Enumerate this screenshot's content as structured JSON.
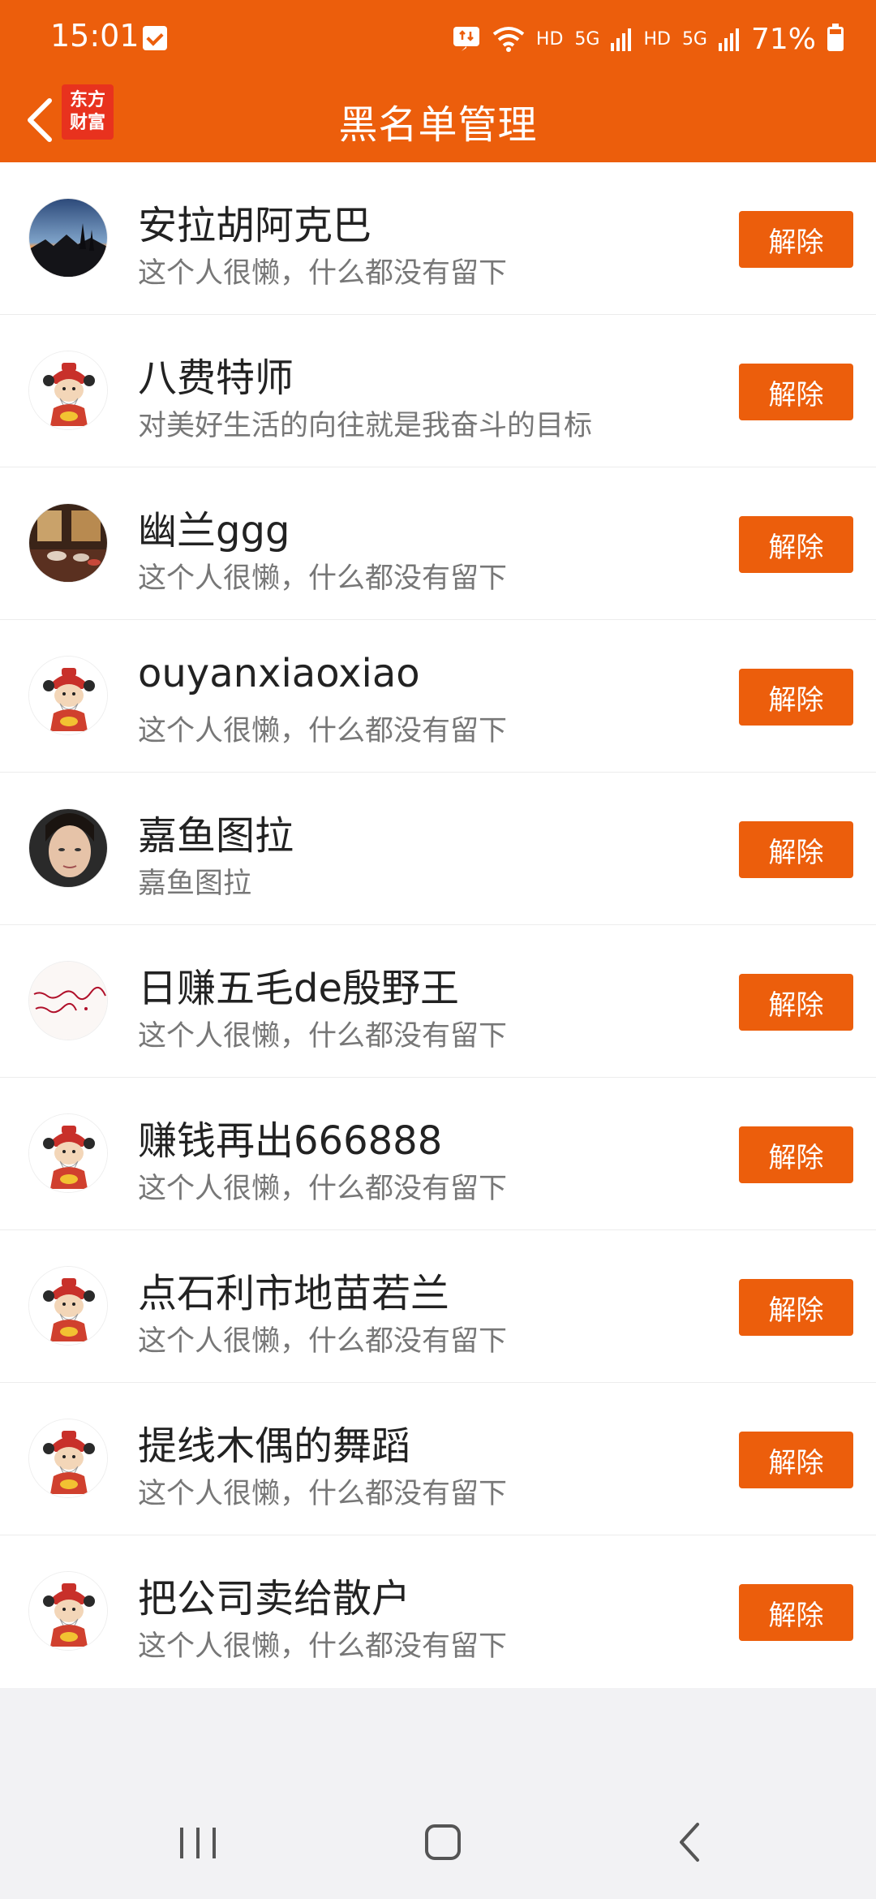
{
  "status_bar": {
    "time": "15:01",
    "hd1": "HD",
    "net1": "5G",
    "hd2": "HD",
    "net2": "5G",
    "battery": "71%"
  },
  "header": {
    "logo_line1": "东方",
    "logo_line2": "财富",
    "title": "黑名单管理"
  },
  "blocked_users": [
    {
      "name": "安拉胡阿克巴",
      "bio": "这个人很懒，什么都没有留下",
      "action": "解除",
      "avatar": "landscape-photo"
    },
    {
      "name": "八费特师",
      "bio": "对美好生活的向往就是我奋斗的目标",
      "action": "解除",
      "avatar": "god-of-wealth"
    },
    {
      "name": "幽兰ggg",
      "bio": "这个人很懒，什么都没有留下",
      "action": "解除",
      "avatar": "tea-room-photo"
    },
    {
      "name": "ouyanxiaoxiao",
      "bio": "这个人很懒，什么都没有留下",
      "action": "解除",
      "avatar": "god-of-wealth"
    },
    {
      "name": "嘉鱼图拉",
      "bio": "嘉鱼图拉",
      "action": "解除",
      "avatar": "portrait-photo"
    },
    {
      "name": "日赚五毛de殷野王",
      "bio": "这个人很懒，什么都没有留下",
      "action": "解除",
      "avatar": "calligraphy-image"
    },
    {
      "name": "赚钱再出666888",
      "bio": "这个人很懒，什么都没有留下",
      "action": "解除",
      "avatar": "god-of-wealth"
    },
    {
      "name": "点石利市地苗若兰",
      "bio": "这个人很懒，什么都没有留下",
      "action": "解除",
      "avatar": "god-of-wealth"
    },
    {
      "name": "提线木偶的舞蹈",
      "bio": "这个人很懒，什么都没有留下",
      "action": "解除",
      "avatar": "god-of-wealth"
    },
    {
      "name": "把公司卖给散户",
      "bio": "这个人很懒，什么都没有留下",
      "action": "解除",
      "avatar": "god-of-wealth"
    }
  ],
  "colors": {
    "accent": "#ec5e0c",
    "background": "#f2f2f4"
  }
}
